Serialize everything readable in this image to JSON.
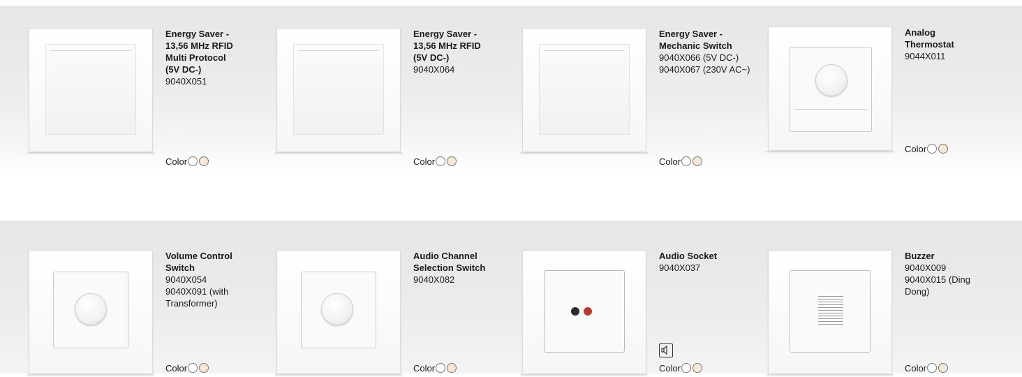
{
  "colors": {
    "swatch_white": "#ffffff",
    "swatch_cream": "#f5e8d8",
    "swatch_border": "#7a7a7a",
    "band_gray": "#e9e9e9"
  },
  "products": [
    {
      "title": "Energy Saver -\n13,56 MHz RFID\nMulti Protocol\n(5V DC-)",
      "code": "9040X051",
      "color_label": "Color"
    },
    {
      "title": "Energy Saver -\n13,56 MHz RFID\n(5V DC-)",
      "code": "9040X064",
      "color_label": "Color"
    },
    {
      "title": "Energy Saver -\nMechanic Switch",
      "code": "9040X066 (5V DC-)\n9040X067 (230V AC~)",
      "color_label": "Color"
    },
    {
      "title": "Analog\nThermostat",
      "code": "9044X011",
      "color_label": "Color"
    },
    {
      "title": "Volume Control\nSwitch",
      "code": "9040X054\n9040X091 (with\nTransformer)",
      "color_label": "Color"
    },
    {
      "title": "Audio Channel\nSelection Switch",
      "code": "9040X082",
      "color_label": "Color"
    },
    {
      "title": "Audio Socket",
      "code": "9040X037",
      "color_label": "Color",
      "badge_icon": "speaker-icon"
    },
    {
      "title": "Buzzer",
      "code": "9040X009\n9040X015 (Ding\nDong)",
      "color_label": "Color"
    }
  ]
}
